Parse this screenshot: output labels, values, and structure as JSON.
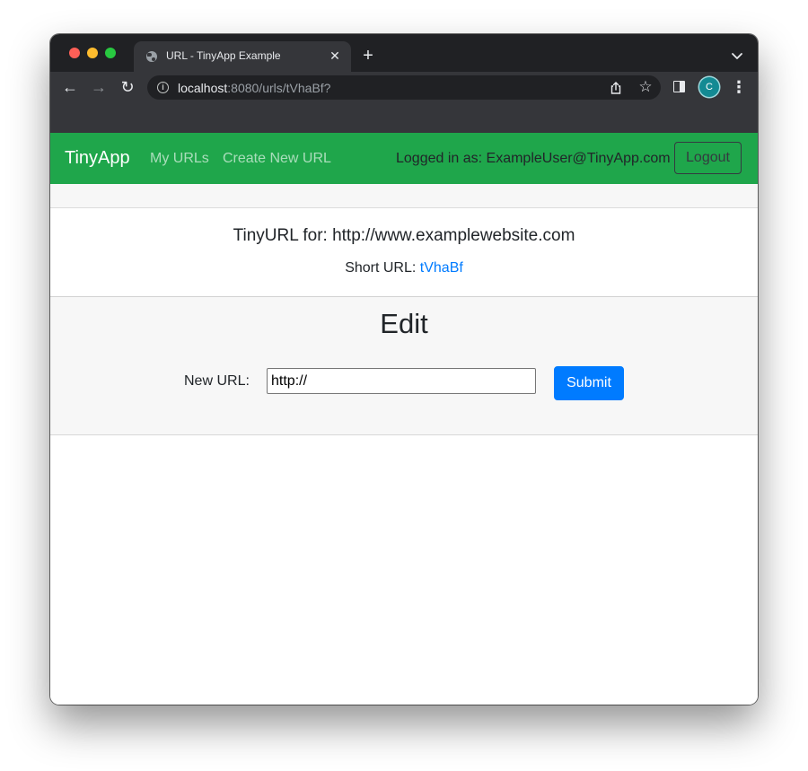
{
  "browser": {
    "tab_title": "URL - TinyApp Example",
    "tab_close": "✕",
    "new_tab": "+",
    "url_host": "localhost",
    "url_rest": ":8080/urls/tVhaBf?",
    "profile_initial": "C",
    "icons": [
      "globe-icon",
      "close-icon",
      "plus-icon",
      "chevron-down-icon",
      "back-arrow-icon",
      "forward-arrow-icon",
      "reload-icon",
      "info-icon",
      "share-icon",
      "star-icon",
      "side-panel-icon",
      "kebab-menu-icon"
    ]
  },
  "navbar": {
    "brand": "TinyApp",
    "links": [
      "My URLs",
      "Create New URL"
    ],
    "logged_in": "Logged in as: ExampleUser@TinyApp.com",
    "logout": "Logout",
    "color": "#1fa64b"
  },
  "info_card": {
    "title": "TinyURL for: http://www.examplewebsite.com",
    "short_label": "Short URL: ",
    "short_value": "tVhaBf"
  },
  "edit_card": {
    "heading": "Edit",
    "label": "New URL:",
    "input_value": "http://",
    "submit": "Submit",
    "submit_color": "#007bff"
  }
}
